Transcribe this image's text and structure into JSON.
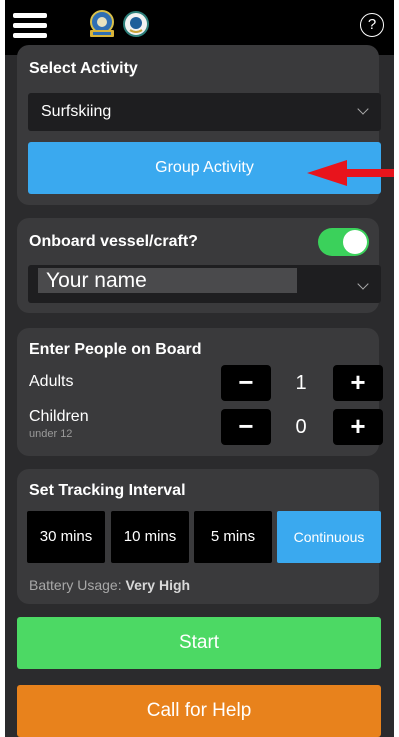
{
  "header": {
    "menu_icon": "hamburger-icon",
    "logo_left": "coast-guard-logo",
    "logo_right": "marine-rescue-logo",
    "help_icon": "help-icon",
    "help_glyph": "?"
  },
  "activity": {
    "title": "Select Activity",
    "selected": "Surfskiing",
    "group_button": "Group Activity"
  },
  "vessel": {
    "title": "Onboard vessel/craft?",
    "toggle_on": true,
    "name_value": "Your name"
  },
  "people": {
    "title": "Enter People on Board",
    "adults_label": "Adults",
    "adults_count": "1",
    "children_label": "Children",
    "children_sub": "under 12",
    "children_count": "0",
    "minus": "−",
    "plus": "+"
  },
  "tracking": {
    "title": "Set Tracking Interval",
    "options": [
      "30 mins",
      "10 mins",
      "5 mins",
      "Continuous"
    ],
    "selected": "Continuous",
    "battery_label": "Battery Usage:",
    "battery_value": "Very High"
  },
  "actions": {
    "start": "Start",
    "help": "Call for Help"
  },
  "colors": {
    "accent_blue": "#3aa9ef",
    "start_green": "#4cd964",
    "help_orange": "#e8821c",
    "toggle_green": "#3bd15b",
    "annotation_red": "#e8141c"
  }
}
